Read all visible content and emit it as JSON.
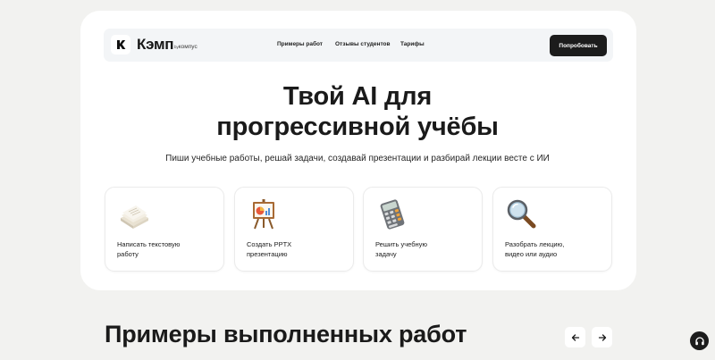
{
  "header": {
    "logo_text": "Кэмп",
    "logo_by": "by",
    "logo_partner": "компус",
    "nav": [
      {
        "label": "Примеры работ"
      },
      {
        "label": "Отзывы студентов"
      },
      {
        "label": "Тарифы"
      }
    ],
    "cta_label": "Попробовать"
  },
  "hero": {
    "title_line1": "Твой AI для",
    "title_line2": "прогрессивной учёбы",
    "subtitle": "Пиши учебные работы, решай задачи, создавай презентации и разбирай лекции весте с ИИ"
  },
  "features": [
    {
      "icon": "paper-stack-icon",
      "label": "Написать текстовую\nработу"
    },
    {
      "icon": "presentation-board-icon",
      "label": "Создать PPTX\nпрезентацию"
    },
    {
      "icon": "calculator-icon",
      "label": "Решить учебную\nзадачу"
    },
    {
      "icon": "magnifier-icon",
      "label": "Разобрать лекцию,\nвидео или аудио"
    }
  ],
  "examples": {
    "title": "Примеры выполненных работ",
    "prev_icon": "arrow-left-icon",
    "next_icon": "arrow-right-icon"
  },
  "support_icon": "headphones-icon",
  "colors": {
    "page_bg": "#f2f2f0",
    "card_bg": "#ffffff",
    "navbar_bg": "#f3f5f7",
    "cta_bg": "#1c1c1c",
    "text": "#1a1a1a"
  }
}
